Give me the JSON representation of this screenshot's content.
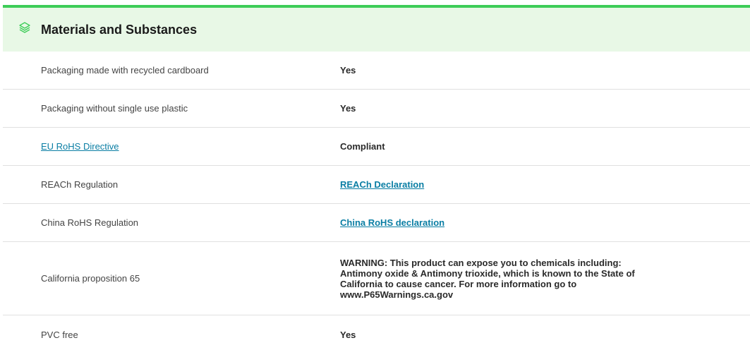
{
  "header": {
    "title": "Materials and Substances",
    "icon": "layers-icon"
  },
  "colors": {
    "accent_bar": "#3dcd58",
    "header_bg": "#e8f8e6",
    "link": "#0a7ea4"
  },
  "rows": [
    {
      "label": "Packaging made with recycled cardboard",
      "value": "Yes",
      "label_is_link": false,
      "value_is_link": false
    },
    {
      "label": "Packaging without single use plastic",
      "value": "Yes",
      "label_is_link": false,
      "value_is_link": false
    },
    {
      "label": "EU RoHS Directive",
      "value": "Compliant",
      "label_is_link": true,
      "value_is_link": false
    },
    {
      "label": "REACh Regulation",
      "value": "REACh Declaration",
      "label_is_link": false,
      "value_is_link": true
    },
    {
      "label": "China RoHS Regulation",
      "value": "China RoHS declaration",
      "label_is_link": false,
      "value_is_link": true
    },
    {
      "label": "California proposition 65",
      "value": "WARNING: This product can expose you to chemicals including: Antimony oxide & Antimony trioxide, which is known to the State of California to cause cancer. For more information go to www.P65Warnings.ca.gov",
      "label_is_link": false,
      "value_is_link": false
    },
    {
      "label": "PVC free",
      "value": "Yes",
      "label_is_link": false,
      "value_is_link": false
    }
  ]
}
